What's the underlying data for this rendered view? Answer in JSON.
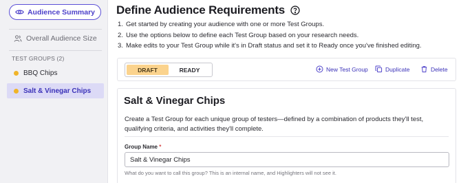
{
  "sidebar": {
    "summary_button": "Audience Summary",
    "overall": "Overall Audience Size",
    "groups_header": "TEST GROUPS (2)",
    "groups": [
      {
        "label": "BBQ Chips",
        "active": false
      },
      {
        "label": "Salt & Vinegar Chips",
        "active": true
      }
    ],
    "dot_color": "#f0b429"
  },
  "main": {
    "title": "Define Audience Requirements",
    "steps": [
      {
        "num": "1.",
        "text": "Get started by creating your audience with one or more Test Groups."
      },
      {
        "num": "2.",
        "text": "Use the options below to define each Test Group based on your research needs."
      },
      {
        "num": "3.",
        "text": "Make edits to your Test Group while it's in Draft status and set it to Ready once you've finished editing."
      }
    ]
  },
  "toolbar": {
    "status_options": [
      "DRAFT",
      "READY"
    ],
    "selected_status": "DRAFT",
    "new_group": "New Test Group",
    "duplicate": "Duplicate",
    "delete": "Delete"
  },
  "card": {
    "title": "Salt & Vinegar Chips",
    "description": "Create a Test Group for each unique group of testers—defined by a combination of products they'll test, qualifying criteria, and activities they'll complete.",
    "field_label": "Group Name",
    "required_mark": "*",
    "field_value": "Salt & Vinegar Chips",
    "field_help": "What do you want to call this group? This is an internal name, and Highlighters will not see it."
  },
  "colors": {
    "accent": "#4b3fc9",
    "draft_highlight": "#fbd38d",
    "active_item_bg": "#dcdaf6"
  }
}
